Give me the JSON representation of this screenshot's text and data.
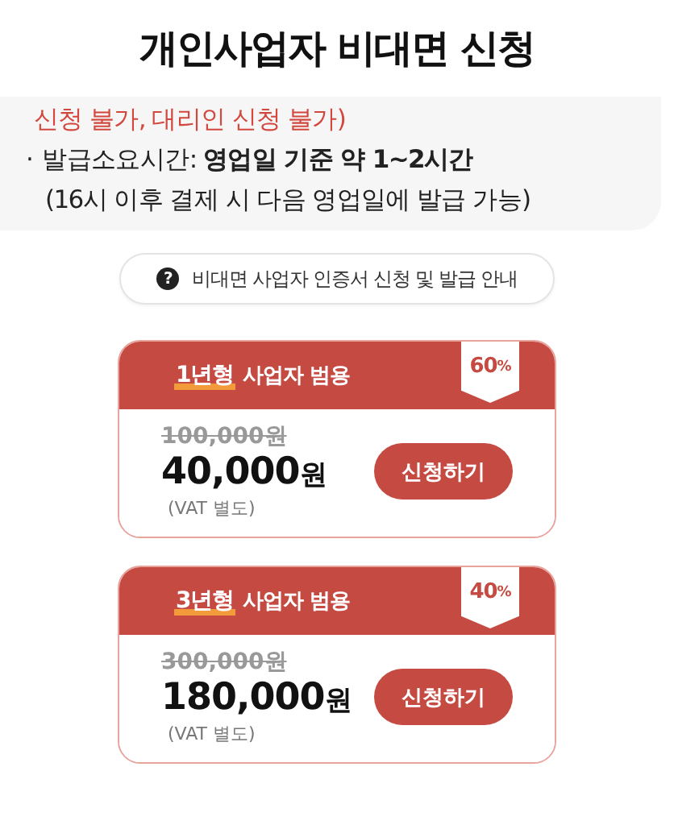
{
  "title": "개인사업자 비대면 신청",
  "notice": {
    "warning": "신청 불가, 대리인 신청 불가)",
    "bullet": "·",
    "line": "발급소요시간: **영업일 기준 약 1~2시간**",
    "note": "(16시 이후 결제 시 다음 영업일에 발급 가능)"
  },
  "guide_button": {
    "icon": "?",
    "label": "비대면 사업자 인증서 신청 및 발급 안내"
  },
  "plans": [
    {
      "term": "1년형",
      "name": "사업자 범용",
      "discount": "60",
      "discount_unit": "%",
      "original_price": "100,000원",
      "price": "40,000",
      "currency": "원",
      "vat": "(VAT 별도)",
      "button": "신청하기"
    },
    {
      "term": "3년형",
      "name": "사업자 범용",
      "discount": "40",
      "discount_unit": "%",
      "original_price": "300,000원",
      "price": "180,000",
      "currency": "원",
      "vat": "(VAT 별도)",
      "button": "신청하기"
    }
  ]
}
